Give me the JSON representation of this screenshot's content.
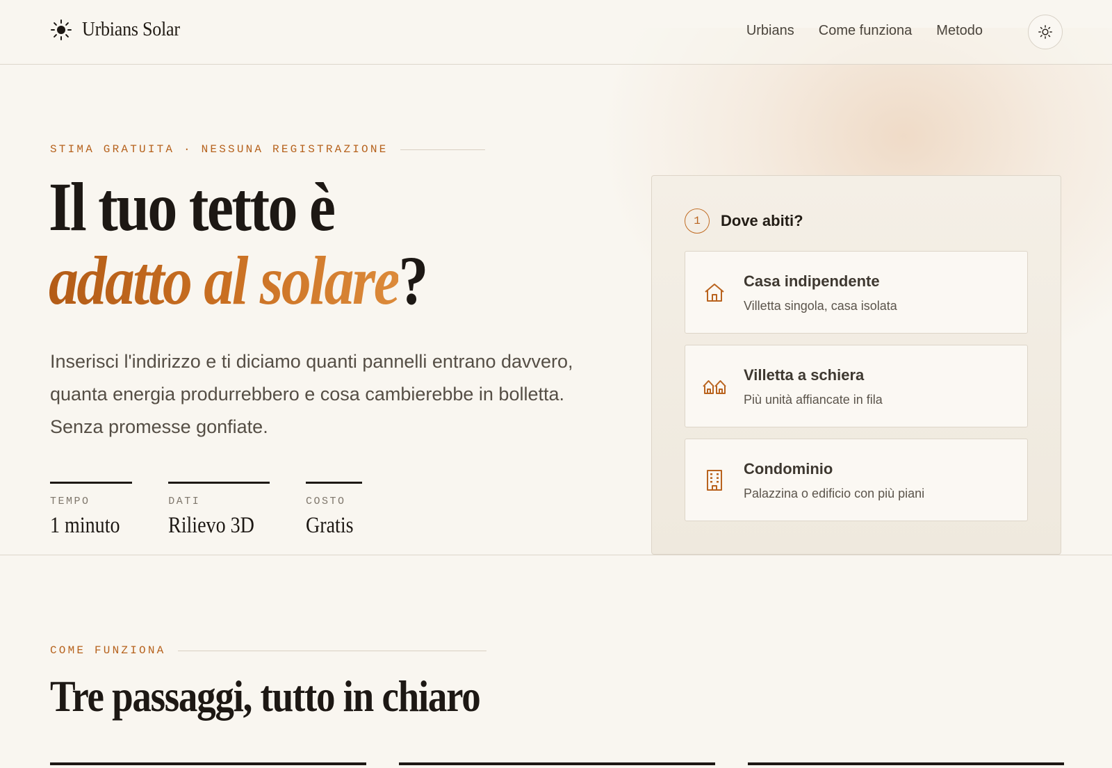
{
  "header": {
    "brand": "Urbians Solar",
    "brand_icon": "sun-icon",
    "nav": [
      "Urbians",
      "Come funziona",
      "Metodo"
    ],
    "theme_toggle_icon": "sun-outline-icon"
  },
  "hero": {
    "eyebrow": "STIMA GRATUITA · NESSUNA REGISTRAZIONE",
    "title_line1": "Il tuo tetto è",
    "title_accent": "adatto al solare",
    "title_mark": "?",
    "lead": "Inserisci l'indirizzo e ti diciamo quanti pannelli entrano davvero, quanta energia produrrebbero e cosa cambierebbe in bolletta. Senza promesse gonfiate.",
    "stats": [
      {
        "label": "TEMPO",
        "value": "1 minuto"
      },
      {
        "label": "DATI",
        "value": "Rilievo 3D"
      },
      {
        "label": "COSTO",
        "value": "Gratis"
      }
    ]
  },
  "card": {
    "step_number": "1",
    "step_title": "Dove abiti?",
    "options": [
      {
        "title": "Casa indipendente",
        "desc": "Villetta singola, casa isolata",
        "icon": "house-icon"
      },
      {
        "title": "Villetta a schiera",
        "desc": "Più unità affiancate in fila",
        "icon": "row-houses-icon"
      },
      {
        "title": "Condominio",
        "desc": "Palazzina o edificio con più piani",
        "icon": "building-icon"
      }
    ]
  },
  "section2": {
    "eyebrow": "COME FUNZIONA",
    "title": "Tre passaggi, tutto in chiaro"
  },
  "colors": {
    "accent": "#b6621d",
    "background": "#f9f6f0",
    "text": "#1d1814"
  }
}
